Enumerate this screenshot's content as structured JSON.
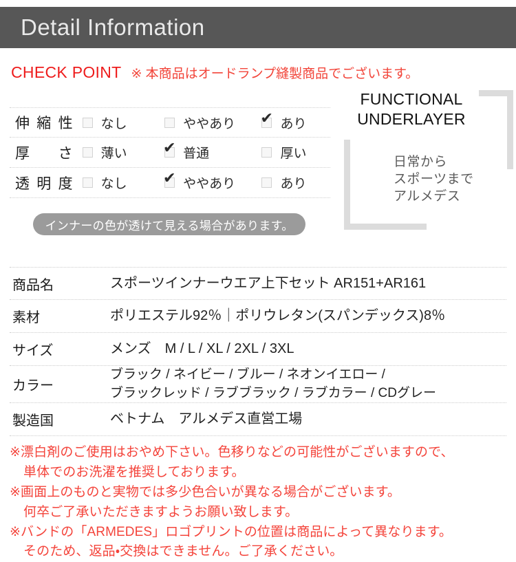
{
  "header": {
    "title": "Detail Information"
  },
  "checkpoint": {
    "title": "CHECK POINT",
    "note": "※ 本商品はオードランプ縫製商品でございます。",
    "title_color": "#ee1c1c",
    "note_color": "#f2453a"
  },
  "functional_panel": {
    "title_line1": "FUNCTIONAL",
    "title_line2": "UNDERLAYER",
    "sub_line1": "日常から",
    "sub_line2": "スポーツまで",
    "sub_line3": "アルメデス"
  },
  "spec_table": {
    "rows": [
      {
        "label": "伸縮性",
        "options": [
          {
            "text": "なし",
            "checked": false
          },
          {
            "text": "ややあり",
            "checked": false
          },
          {
            "text": "あり",
            "checked": true
          }
        ]
      },
      {
        "label": "厚さ",
        "options": [
          {
            "text": "薄い",
            "checked": false
          },
          {
            "text": "普通",
            "checked": true
          },
          {
            "text": "厚い",
            "checked": false
          }
        ]
      },
      {
        "label": "透明度",
        "options": [
          {
            "text": "なし",
            "checked": false
          },
          {
            "text": "ややあり",
            "checked": true
          },
          {
            "text": "あり",
            "checked": false
          }
        ]
      }
    ]
  },
  "pill": {
    "text": "インナーの色が透けて見える場合があります。",
    "bg_color": "#9b9b9b"
  },
  "info_table": {
    "rows": [
      {
        "label": "商品名",
        "value": "スポーツインナーウエア上下セット AR151+AR161"
      },
      {
        "label": "素材",
        "value": "ポリエステル92％｜ポリウレタン(スパンデックス)8％"
      },
      {
        "label": "サイズ",
        "value": "メンズ　M / L / XL / 2XL / 3XL"
      },
      {
        "label": "カラー",
        "value_line1": "ブラック / ネイビー / ブルー / ネオンイエロー /",
        "value_line2": "ブラックレッド / ラブブラック / ラブカラー / CDグレー"
      },
      {
        "label": "製造国",
        "value": "ベトナム　アルメデス直営工場"
      }
    ]
  },
  "notes": {
    "color": "#f4443b",
    "lines": [
      "※漂白剤のご使用はおやめ下さい。色移りなどの可能性がございますので、",
      "単体でのお洗濯を推奨しております。",
      "※画面上のものと実物では多少色合いが異なる場合がございます。",
      "何卒ご了承いただきますようお願い致します。",
      "※バンドの「ARMEDES」ロゴプリントの位置は商品によって異なります。",
      "そのため、返品・交換はできません。ご了承ください。"
    ],
    "indent_flags": [
      false,
      true,
      false,
      true,
      false,
      true
    ]
  }
}
